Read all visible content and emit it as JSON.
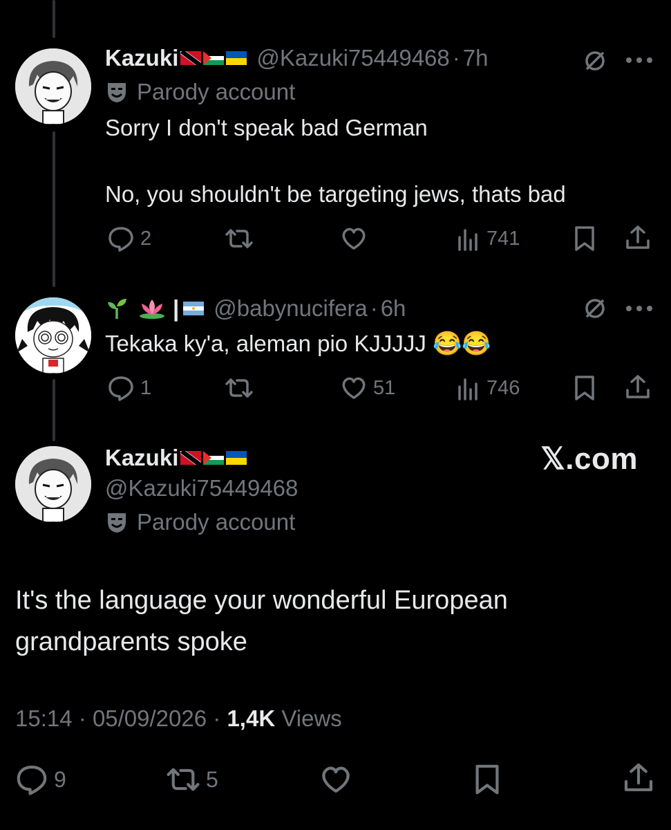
{
  "tweet1": {
    "name": "Kazuki",
    "handle": "@Kazuki75449468",
    "sep": "·",
    "time": "7h",
    "badge": "Parody account",
    "line1": "Sorry I don't speak bad German",
    "line2": "No, you shouldn't be targeting jews, thats bad",
    "replies": "2",
    "likes": "",
    "views": "741"
  },
  "tweet2": {
    "name_sep": "|",
    "handle": "@babynucifera",
    "sep": "·",
    "time": "6h",
    "text": "Tekaka ky'a, aleman pio KJJJJJ",
    "emoji": "😂😂",
    "replies": "1",
    "likes": "51",
    "views": "746"
  },
  "main": {
    "name": "Kazuki",
    "handle": "@Kazuki75449468",
    "badge": "Parody account",
    "watermark": "𝕏.com",
    "text_line1": "It's the language your wonderful European",
    "text_line2": "grandparents spoke",
    "time": "15:14",
    "date": "05/09/2026",
    "sep": "·",
    "views_count": "1,4K",
    "views_label": "Views",
    "replies": "9",
    "reposts": "5"
  },
  "icons": [
    "comment-icon",
    "retweet-icon",
    "heart-icon",
    "views-icon",
    "bookmark-icon",
    "share-icon",
    "grok-icon",
    "more-icon",
    "parody-mask-icon"
  ],
  "colors": {
    "bg": "#000000",
    "text": "#e7e9ea",
    "gray": "#71767b",
    "line": "#2f3336"
  }
}
